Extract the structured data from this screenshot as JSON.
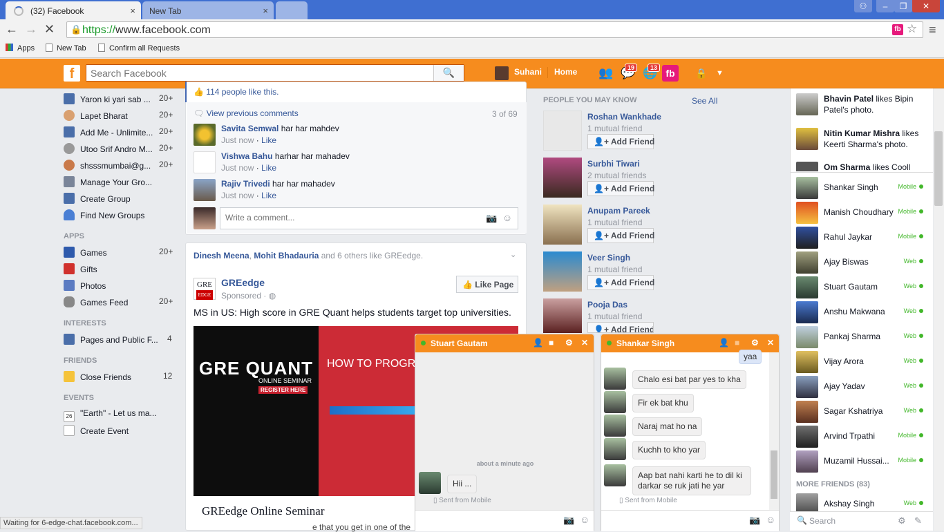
{
  "browser": {
    "tabs": [
      {
        "label": "(32) Facebook",
        "close": "×"
      },
      {
        "label": "New Tab",
        "close": "×"
      }
    ],
    "url_scheme": "https://",
    "url_host": "www.facebook.com",
    "bookmarks": [
      "Apps",
      "New Tab",
      "Confirm all Requests"
    ],
    "status": "Waiting for 6-edge-chat.facebook.com..."
  },
  "fb": {
    "search_placeholder": "Search Facebook",
    "user": "Suhani",
    "home": "Home",
    "badge_messages": "19",
    "badge_notifications": "13",
    "fb_icon": "fb"
  },
  "left": {
    "groups": [
      {
        "label": "Yaron ki yari sab ...",
        "count": "20+"
      },
      {
        "label": "Lapet Bharat",
        "count": "20+"
      },
      {
        "label": "Add Me - Unlimite...",
        "count": "20+"
      },
      {
        "label": "Utoo Srif Andro M...",
        "count": "20+"
      },
      {
        "label": "shsssmumbai@g...",
        "count": "20+"
      },
      {
        "label": "Manage Your Gro...",
        "count": ""
      },
      {
        "label": "Create Group",
        "count": ""
      },
      {
        "label": "Find New Groups",
        "count": ""
      }
    ],
    "apps_head": "APPS",
    "apps": [
      {
        "label": "Games",
        "count": "20+"
      },
      {
        "label": "Gifts",
        "count": ""
      },
      {
        "label": "Photos",
        "count": ""
      },
      {
        "label": "Games Feed",
        "count": "20+"
      }
    ],
    "interests_head": "INTERESTS",
    "interests": [
      {
        "label": "Pages and Public F...",
        "count": "4"
      }
    ],
    "friends_head": "FRIENDS",
    "friends": [
      {
        "label": "Close Friends",
        "count": "12"
      }
    ],
    "events_head": "EVENTS",
    "events": [
      {
        "label": "\"Earth\" - Let us ma...",
        "date": "26"
      },
      {
        "label": "Create Event"
      }
    ]
  },
  "feed": {
    "likes": "114 people like this.",
    "view_prev": "View previous comments",
    "comment_count": "3 of 69",
    "comments": [
      {
        "name": "Savita Semwal",
        "text": "har har mahdev",
        "time": "Just now",
        "like": "Like"
      },
      {
        "name": "Vishwa Bahu",
        "text": "harhar har mahadev",
        "time": "Just now",
        "like": "Like"
      },
      {
        "name": "Rajiv Trivedi",
        "text": "har har mahadev",
        "time": "Just now",
        "like": "Like"
      }
    ],
    "write_placeholder": "Write a comment...",
    "story_likers_1": "Dinesh Meena",
    "story_likers_sep": ", ",
    "story_likers_2": "Mohit Bhadauria",
    "story_likers_rest": " and 6 others like GREedge.",
    "page_name": "GREedge",
    "sponsored": "Sponsored",
    "like_page": "Like Page",
    "page_logo": "GRE",
    "ad_text": "MS in US: High score in GRE Quant helps students target top universities.",
    "ad_title1": "GRE QUANT",
    "ad_sub": "ONLINE SEMINAR",
    "ad_register": "REGISTER HERE",
    "ad_title2": "HOW TO  PROGR",
    "ad_caption": "GREedge Online Seminar",
    "ad_caption_more": "e that you get in one of the"
  },
  "pymk": {
    "head": "PEOPLE YOU MAY KNOW",
    "see_all": "See All",
    "add": "Add Friend",
    "people": [
      {
        "name": "Roshan Wankhade",
        "mutual": "1 mutual friend"
      },
      {
        "name": "Surbhi Tiwari",
        "mutual": "2 mutual friends"
      },
      {
        "name": "Anupam Pareek",
        "mutual": "1 mutual friend"
      },
      {
        "name": "Veer Singh",
        "mutual": "1 mutual friend"
      },
      {
        "name": "Pooja Das",
        "mutual": "1 mutual friend"
      }
    ]
  },
  "ticker": [
    {
      "name": "Bhavin Patel",
      "rest": " likes Bipin Patel's photo."
    },
    {
      "name": "Nitin Kumar Mishra",
      "rest": " likes Keerti Sharma's photo."
    },
    {
      "name": "Om Sharma",
      "rest": " likes Cooll"
    }
  ],
  "chat_list": [
    {
      "name": "Shankar Singh",
      "status": "Mobile"
    },
    {
      "name": "Manish Choudhary",
      "status": "Mobile"
    },
    {
      "name": "Rahul Jaykar",
      "status": "Mobile"
    },
    {
      "name": "Ajay Biswas",
      "status": "Web"
    },
    {
      "name": "Stuart Gautam",
      "status": "Web"
    },
    {
      "name": "Anshu Makwana",
      "status": "Web"
    },
    {
      "name": "Pankaj Sharma",
      "status": "Web"
    },
    {
      "name": "Vijay Arora",
      "status": "Web"
    },
    {
      "name": "Ajay Yadav",
      "status": "Web"
    },
    {
      "name": "Sagar Kshatriya",
      "status": "Web"
    },
    {
      "name": "Arvind Trpathi",
      "status": "Mobile"
    },
    {
      "name": "Muzamil Hussai...",
      "status": "Mobile"
    }
  ],
  "more_friends": "MORE FRIENDS (83)",
  "more_friend": {
    "name": "Akshay Singh",
    "status": "Web"
  },
  "chat_search": "Search",
  "chat1": {
    "name": "Stuart Gautam",
    "time": "about a minute ago",
    "msg": "Hii ...",
    "sent": "Sent from Mobile"
  },
  "chat2": {
    "name": "Shankar Singh",
    "mine": "yaa",
    "msgs": [
      "Chalo esi bat par yes to kha",
      "Fir ek bat khu",
      "Naraj mat ho na",
      "Kuchh to kho yar",
      "Aap bat nahi karti he to dil ki darkar se ruk jati he yar"
    ],
    "sent": "Sent from Mobile"
  },
  "colors": {
    "fb_orange": "#f68c1e",
    "link": "#365899",
    "online": "#42b72a"
  }
}
